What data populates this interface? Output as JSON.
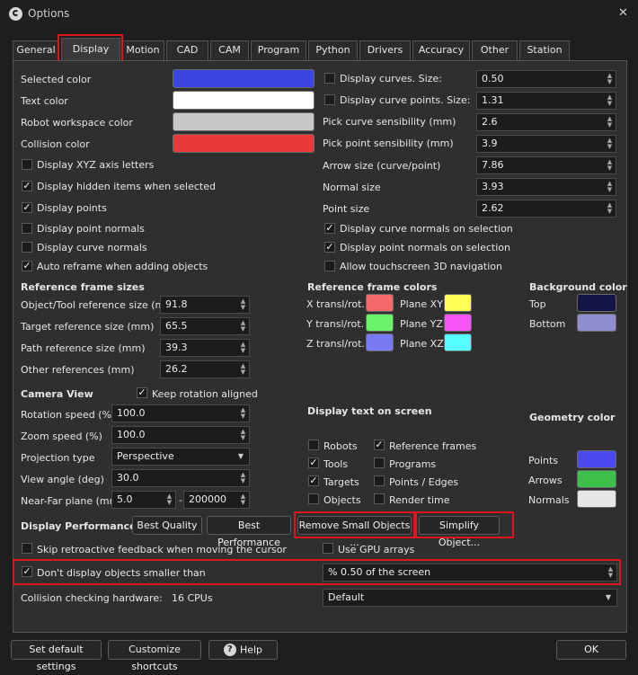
{
  "window": {
    "title": "Options",
    "close_glyph": "✕"
  },
  "tabs": [
    "General",
    "Display",
    "Motion",
    "CAD",
    "CAM",
    "Program",
    "Python",
    "Drivers",
    "Accuracy",
    "Other",
    "Station"
  ],
  "colors": {
    "selected_label": "Selected color",
    "selected_color": "#3b46e0",
    "text_label": "Text color",
    "text_color": "#ffffff",
    "robot_ws_label": "Robot workspace color",
    "robot_ws_color": "#c8c8c8",
    "collision_label": "Collision color",
    "collision_color": "#e83a3a"
  },
  "left_checks": [
    {
      "label": "Display XYZ axis letters",
      "checked": false
    },
    {
      "label": "Display hidden items when selected",
      "checked": true
    },
    {
      "label": "Display points",
      "checked": true
    },
    {
      "label": "Display point normals",
      "checked": false
    },
    {
      "label": "Display curve normals",
      "checked": false
    },
    {
      "label": "Auto reframe when adding objects",
      "checked": true
    }
  ],
  "right_top": {
    "display_curves": {
      "label": "Display curves. Size:",
      "checked": false,
      "value": "0.50"
    },
    "display_curve_points": {
      "label": "Display curve points. Size:",
      "checked": false,
      "value": "1.31"
    },
    "pick_curve": {
      "label": "Pick curve sensibility (mm)",
      "value": "2.6"
    },
    "pick_point": {
      "label": "Pick point sensibility (mm)",
      "value": "3.9"
    },
    "arrow_size": {
      "label": "Arrow size (curve/point)",
      "value": "7.86"
    },
    "normal_size": {
      "label": "Normal size",
      "value": "3.93"
    },
    "point_size": {
      "label": "Point size",
      "value": "2.62"
    },
    "curve_normals_sel": {
      "label": "Display curve normals on selection",
      "checked": true
    },
    "point_normals_sel": {
      "label": "Display point normals on selection",
      "checked": true
    },
    "touchscreen": {
      "label": "Allow touchscreen 3D navigation",
      "checked": false
    }
  },
  "ref_sizes": {
    "heading": "Reference frame sizes",
    "object_tool": {
      "label": "Object/Tool reference size (mm)",
      "value": "91.8"
    },
    "target": {
      "label": "Target reference size (mm)",
      "value": "65.5"
    },
    "path": {
      "label": "Path reference size (mm)",
      "value": "39.3"
    },
    "other": {
      "label": "Other references (mm)",
      "value": "26.2"
    }
  },
  "ref_colors": {
    "heading": "Reference frame colors",
    "x": {
      "label": "X transl/rot.",
      "color": "#f46a6a"
    },
    "y": {
      "label": "Y transl/rot.",
      "color": "#6af46a"
    },
    "z": {
      "label": "Z transl/rot.",
      "color": "#7a7af4"
    },
    "pxy": {
      "label": "Plane XY",
      "color": "#ffff55"
    },
    "pyz": {
      "label": "Plane YZ",
      "color": "#f455f4"
    },
    "pxz": {
      "label": "Plane XZ",
      "color": "#55ffff"
    }
  },
  "background": {
    "heading": "Background color",
    "top_label": "Top",
    "top_color": "#151545",
    "bottom_label": "Bottom",
    "bottom_color": "#8f8fcf"
  },
  "camera": {
    "heading": "Camera View",
    "keep_rotation": {
      "label": "Keep rotation aligned",
      "checked": true
    },
    "rotation_speed": {
      "label": "Rotation speed (%)",
      "value": "100.0"
    },
    "zoom_speed": {
      "label": "Zoom speed (%)",
      "value": "100.0"
    },
    "projection": {
      "label": "Projection type",
      "value": "Perspective"
    },
    "view_angle": {
      "label": "View angle (deg)",
      "value": "30.0"
    },
    "near_far": {
      "label": "Near-Far plane (mm)",
      "near": "5.0",
      "sep": "-",
      "far": "200000"
    }
  },
  "display_text": {
    "heading": "Display text on screen",
    "items": [
      {
        "label": "Robots",
        "checked": false
      },
      {
        "label": "Reference frames",
        "checked": true
      },
      {
        "label": "Tools",
        "checked": true
      },
      {
        "label": "Programs",
        "checked": false
      },
      {
        "label": "Targets",
        "checked": true
      },
      {
        "label": "Points / Edges",
        "checked": false
      },
      {
        "label": "Objects",
        "checked": false
      },
      {
        "label": "Render time",
        "checked": false
      }
    ]
  },
  "geometry": {
    "heading": "Geometry color",
    "points_label": "Points",
    "points_color": "#4a4aee",
    "arrows_label": "Arrows",
    "arrows_color": "#3cc04a",
    "normals_label": "Normals",
    "normals_color": "#e6e6e6"
  },
  "performance": {
    "heading": "Display Performance",
    "best_quality": "Best Quality",
    "best_performance": "Best Performance",
    "remove_small": "Remove Small Objects ...",
    "simplify": "Simplify Object...",
    "skip_retro": {
      "label": "Skip retroactive feedback when moving the cursor",
      "checked": false
    },
    "gpu_arrays": {
      "label": "Use GPU arrays",
      "checked": false
    },
    "dont_display": {
      "label": "Don't display objects smaller than",
      "checked": true
    },
    "screen_percent": "% 0.50 of the screen"
  },
  "collision_hw": {
    "label": "Collision checking hardware:",
    "cpus": "16 CPUs",
    "value": "Default"
  },
  "footer": {
    "set_default": "Set default settings",
    "shortcuts": "Customize shortcuts",
    "help": "Help",
    "ok": "OK"
  }
}
